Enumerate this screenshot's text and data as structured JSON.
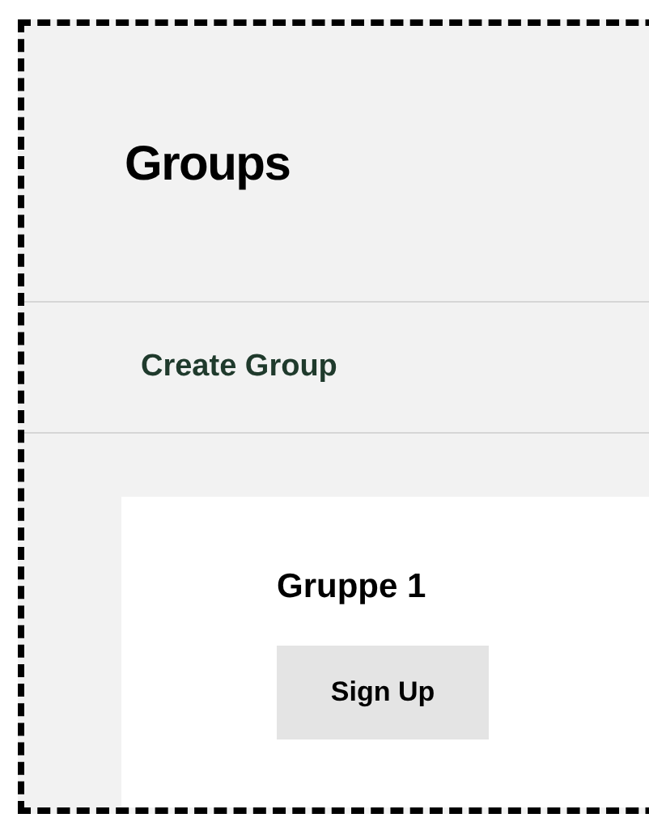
{
  "header": {
    "title": "Groups"
  },
  "actions": [
    {
      "label": "Create Group"
    }
  ],
  "groups": [
    {
      "name": "Gruppe 1",
      "button": "Sign Up"
    }
  ]
}
